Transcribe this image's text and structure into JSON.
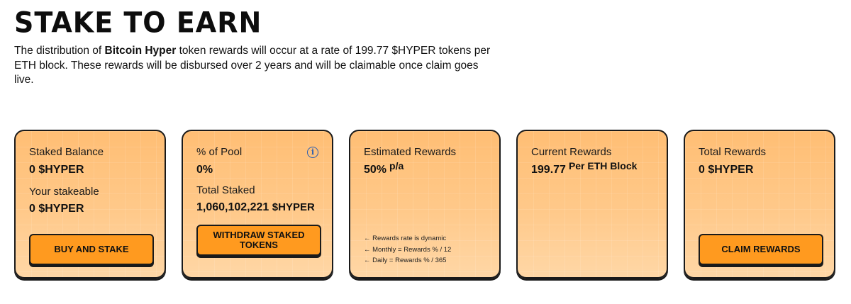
{
  "header": {
    "title": "STAKE TO EARN",
    "intro_prefix": "The distribution of ",
    "intro_bold": "Bitcoin Hyper",
    "intro_suffix": " token rewards will occur at a rate of 199.77 $HYPER tokens per ETH block. These rewards will be disbursed over 2 years and will be claimable once claim goes live."
  },
  "cards": {
    "staked": {
      "label": "Staked Balance",
      "value": "0 $HYPER",
      "label2": "Your stakeable",
      "value2": "0 $HYPER",
      "button": "BUY AND STAKE"
    },
    "pool": {
      "label": "% of Pool",
      "value": "0%",
      "label2": "Total Staked",
      "value2_number": "1,060,102,221",
      "value2_unit": "$HYPER",
      "button": "WITHDRAW STAKED TOKENS",
      "info_icon": "info-icon"
    },
    "estimated": {
      "label": "Estimated Rewards",
      "value": "50%",
      "suffix": "p/a",
      "notes": [
        "← Rewards rate is dynamic",
        "← Monthly = Rewards % / 12",
        "← Daily = Rewards % / 365"
      ]
    },
    "current": {
      "label": "Current Rewards",
      "value": "199.77",
      "suffix": "Per ETH Block"
    },
    "total": {
      "label": "Total Rewards",
      "value": "0 $HYPER",
      "button": "CLAIM REWARDS"
    }
  },
  "colors": {
    "card_bg": "#ffc98a",
    "button_bg": "#ff9a1f",
    "border": "#1a1a1a",
    "info_icon": "#2a5db0"
  }
}
